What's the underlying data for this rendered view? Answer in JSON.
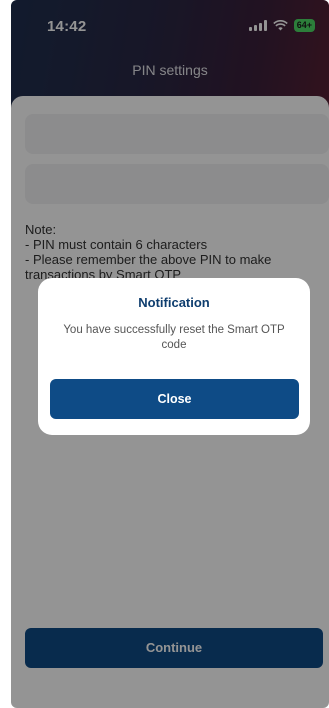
{
  "status_bar": {
    "time": "14:42",
    "battery_label": "64+",
    "icons": [
      "signal-icon",
      "wifi-icon",
      "battery-icon"
    ]
  },
  "header": {
    "title": "PIN settings"
  },
  "note": {
    "heading": "Note:",
    "lines": [
      "- PIN must contain 6 characters",
      "- Please remember the above PIN to make transactions by Smart OTP"
    ]
  },
  "footer": {
    "continue_label": "Continue"
  },
  "dialog": {
    "title": "Notification",
    "message": "You have successfully reset the Smart OTP code",
    "close_label": "Close"
  },
  "colors": {
    "primary": "#0e4b86",
    "dialog_title": "#0e3d6e"
  }
}
